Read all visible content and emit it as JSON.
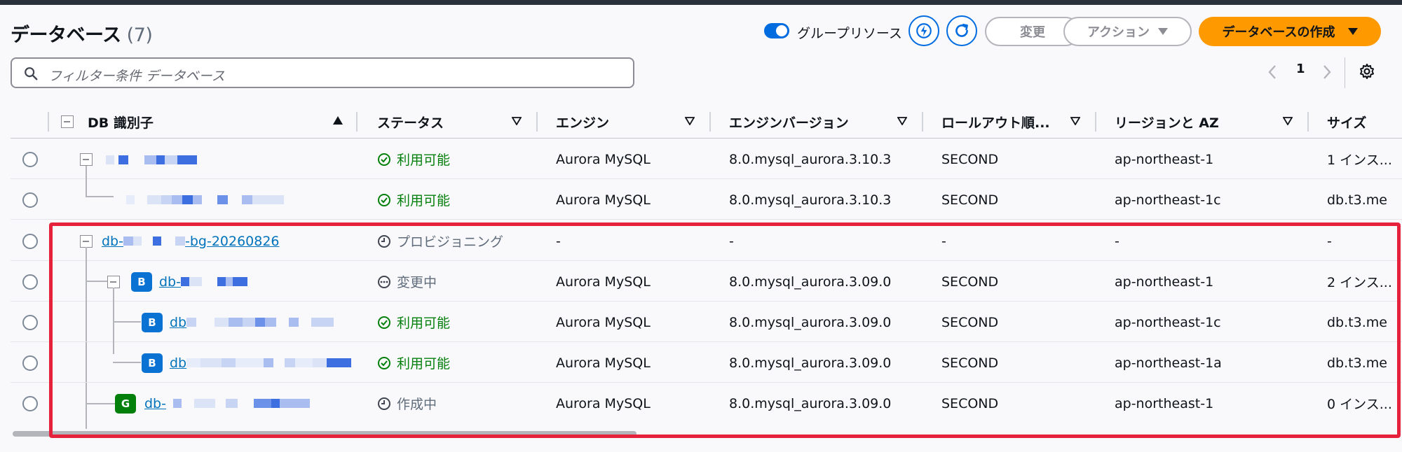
{
  "header": {
    "title": "データベース",
    "count": "(7)",
    "group_toggle_label": "グループリソース",
    "modify_label": "変更",
    "actions_label": "アクション",
    "create_label": "データベースの作成"
  },
  "filter": {
    "placeholder": "フィルター条件 データベース"
  },
  "pagination": {
    "current_page": "1"
  },
  "table": {
    "columns": [
      "DB 識別子",
      "ステータス",
      "エンジン",
      "エンジンバージョン",
      "ロールアウト順...",
      "リージョンと AZ",
      "サイズ"
    ],
    "rows": [
      {
        "identifier": "",
        "status": "利用可能",
        "engine": "Aurora MySQL",
        "version": "8.0.mysql_aurora.3.10.3",
        "rollout": "SECOND",
        "region": "ap-northeast-1",
        "size": "1 インス..."
      },
      {
        "identifier": "",
        "status": "利用可能",
        "engine": "Aurora MySQL",
        "version": "8.0.mysql_aurora.3.10.3",
        "rollout": "SECOND",
        "region": "ap-northeast-1c",
        "size": "db.t3.me"
      },
      {
        "identifier": "db-",
        "identifier_suffix": "-bg-20260826",
        "status": "プロビジョニング",
        "engine": "-",
        "version": "-",
        "rollout": "-",
        "region": "-",
        "size": "-"
      },
      {
        "badge": "B",
        "identifier": "db-",
        "status": "変更中",
        "engine": "Aurora MySQL",
        "version": "8.0.mysql_aurora.3.09.0",
        "rollout": "SECOND",
        "region": "ap-northeast-1",
        "size": "2 インス..."
      },
      {
        "badge": "B",
        "identifier": "db",
        "status": "利用可能",
        "engine": "Aurora MySQL",
        "version": "8.0.mysql_aurora.3.09.0",
        "rollout": "SECOND",
        "region": "ap-northeast-1c",
        "size": "db.t3.me"
      },
      {
        "badge": "B",
        "identifier": "db",
        "status": "利用可能",
        "engine": "Aurora MySQL",
        "version": "8.0.mysql_aurora.3.09.0",
        "rollout": "SECOND",
        "region": "ap-northeast-1a",
        "size": "db.t3.me"
      },
      {
        "badge": "G",
        "identifier": "db-",
        "status": "作成中",
        "engine": "Aurora MySQL",
        "version": "8.0.mysql_aurora.3.09.0",
        "rollout": "SECOND",
        "region": "ap-northeast-1",
        "size": "0 インス..."
      }
    ]
  },
  "colors": {
    "primary": "#ff9900",
    "link": "#0073bb",
    "status_available": "#037f0c",
    "badge_blue": "#0972d3",
    "badge_green": "#037f0c",
    "highlight": "#e5213c"
  },
  "icons": {
    "search": "search-icon",
    "refresh": "refresh-icon",
    "lightning": "lightning-icon",
    "settings": "gear-icon"
  }
}
